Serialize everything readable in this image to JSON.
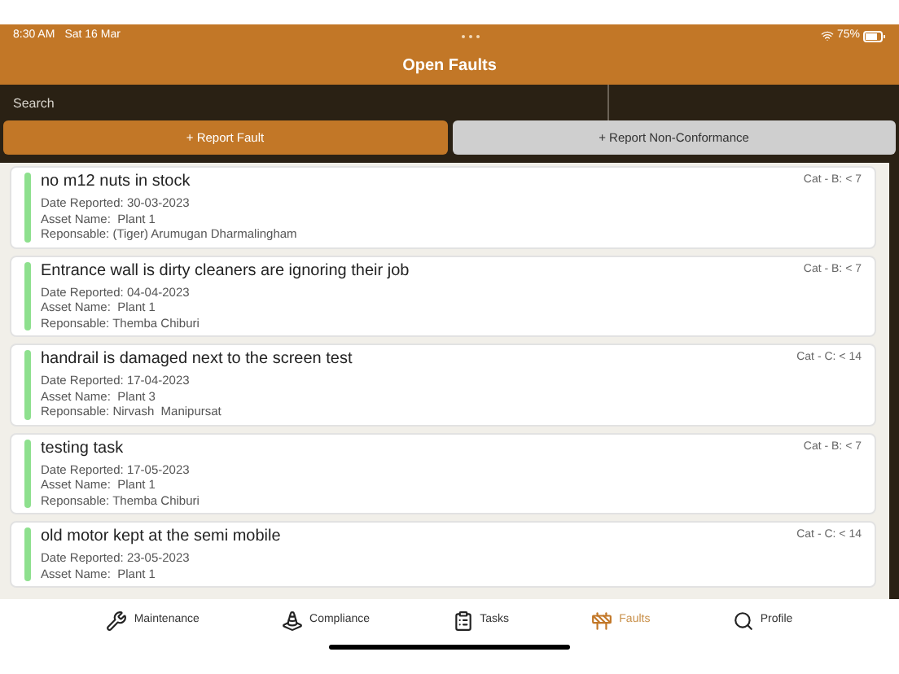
{
  "status_bar": {
    "time": "8:30 AM",
    "date": "Sat 16 Mar",
    "battery": "75%"
  },
  "header": {
    "title": "Open Faults"
  },
  "search": {
    "placeholder": "Search"
  },
  "actions": [
    {
      "label": "+ Report Fault",
      "selected": true
    },
    {
      "label": "+ Report Non-Conformance",
      "selected": false
    }
  ],
  "faults": [
    {
      "title": "no m12 nuts in stock",
      "category": "Cat - B: < 7",
      "details": [
        "Date Reported: 30-03-2023",
        "Asset Name:  Plant 1",
        "Reponsable: (Tiger) Arumugan Dharmalingham"
      ]
    },
    {
      "title": "Entrance wall is dirty cleaners are ignoring their job",
      "category": "Cat - B: < 7",
      "details": [
        "Date Reported: 04-04-2023",
        "Asset Name:  Plant 1",
        "Reponsable: Themba Chiburi"
      ]
    },
    {
      "title": "handrail  is damaged next to the screen test",
      "category": "Cat - C: < 14",
      "details": [
        "Date Reported: 17-04-2023",
        "Asset Name:  Plant 3",
        "Reponsable: Nirvash  Manipursat"
      ]
    },
    {
      "title": "testing task",
      "category": "Cat - B: < 7",
      "details": [
        "Date Reported: 17-05-2023",
        "Asset Name:  Plant 1",
        "Reponsable: Themba Chiburi"
      ]
    },
    {
      "title": "old motor kept at the semi mobile",
      "category": "Cat - C: < 14",
      "details": [
        "Date Reported: 23-05-2023",
        "Asset Name:  Plant 1"
      ]
    }
  ],
  "tab_bar": [
    {
      "kind": "maintenance",
      "label": "Maintenance",
      "selected": false
    },
    {
      "kind": "compliance",
      "label": "Compliance",
      "selected": false
    },
    {
      "kind": "tasks",
      "label": "Tasks",
      "selected": false
    },
    {
      "kind": "faults",
      "label": "Faults",
      "selected": true
    },
    {
      "kind": "profile",
      "label": "Profile",
      "selected": false
    }
  ]
}
